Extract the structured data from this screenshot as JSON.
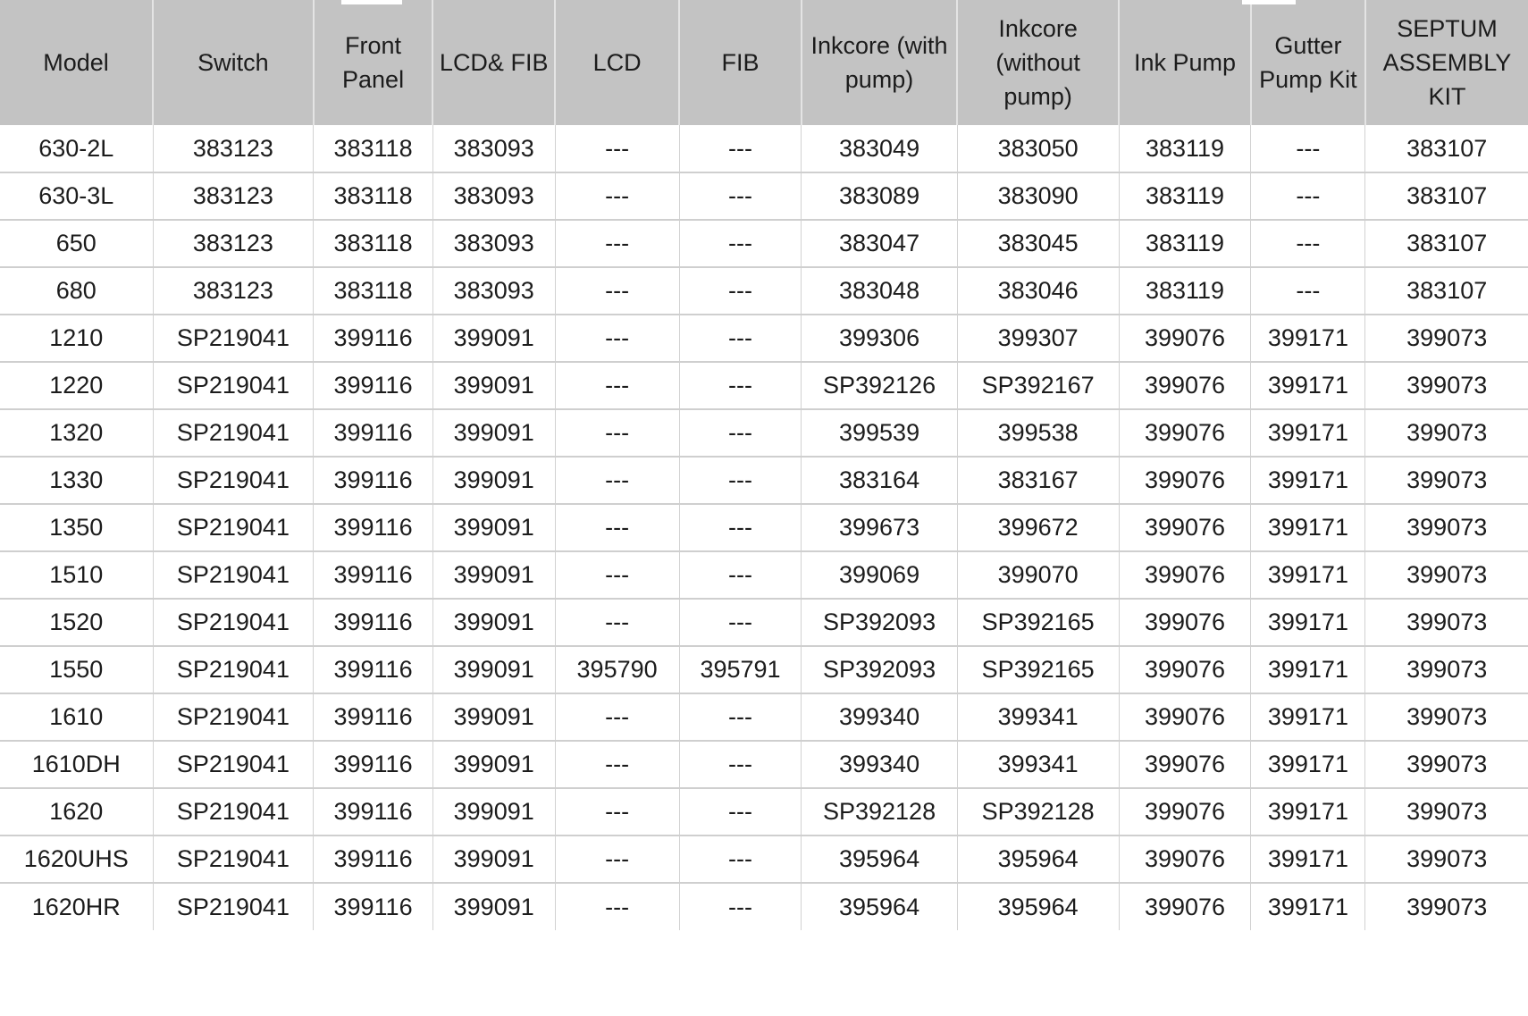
{
  "table": {
    "name": "printer-spare-parts-reference",
    "columns": [
      {
        "key": "model",
        "label": "Model"
      },
      {
        "key": "switch",
        "label": "Switch"
      },
      {
        "key": "front_panel",
        "label": "Front Panel"
      },
      {
        "key": "lcd_fib",
        "label": "LCD& FIB"
      },
      {
        "key": "lcd",
        "label": "LCD"
      },
      {
        "key": "fib",
        "label": "FIB"
      },
      {
        "key": "inkcore_with_pump",
        "label": "Inkcore (with pump)"
      },
      {
        "key": "inkcore_without_pump",
        "label": "Inkcore (without pump)"
      },
      {
        "key": "ink_pump",
        "label": "Ink Pump"
      },
      {
        "key": "gutter_pump_kit",
        "label": "Gutter Pump Kit"
      },
      {
        "key": "septum_assembly_kit",
        "label": "SEPTUM ASSEMBLY KIT"
      }
    ],
    "empty_value": "---",
    "rows": [
      [
        "630-2L",
        "383123",
        "383118",
        "383093",
        "---",
        "---",
        "383049",
        "383050",
        "383119",
        "---",
        "383107"
      ],
      [
        "630-3L",
        "383123",
        "383118",
        "383093",
        "---",
        "---",
        "383089",
        "383090",
        "383119",
        "---",
        "383107"
      ],
      [
        "650",
        "383123",
        "383118",
        "383093",
        "---",
        "---",
        "383047",
        "383045",
        "383119",
        "---",
        "383107"
      ],
      [
        "680",
        "383123",
        "383118",
        "383093",
        "---",
        "---",
        "383048",
        "383046",
        "383119",
        "---",
        "383107"
      ],
      [
        "1210",
        "SP219041",
        "399116",
        "399091",
        "---",
        "---",
        "399306",
        "399307",
        "399076",
        "399171",
        "399073"
      ],
      [
        "1220",
        "SP219041",
        "399116",
        "399091",
        "---",
        "---",
        "SP392126",
        "SP392167",
        "399076",
        "399171",
        "399073"
      ],
      [
        "1320",
        "SP219041",
        "399116",
        "399091",
        "---",
        "---",
        "399539",
        "399538",
        "399076",
        "399171",
        "399073"
      ],
      [
        "1330",
        "SP219041",
        "399116",
        "399091",
        "---",
        "---",
        "383164",
        "383167",
        "399076",
        "399171",
        "399073"
      ],
      [
        "1350",
        "SP219041",
        "399116",
        "399091",
        "---",
        "---",
        "399673",
        "399672",
        "399076",
        "399171",
        "399073"
      ],
      [
        "1510",
        "SP219041",
        "399116",
        "399091",
        "---",
        "---",
        "399069",
        "399070",
        "399076",
        "399171",
        "399073"
      ],
      [
        "1520",
        "SP219041",
        "399116",
        "399091",
        "---",
        "---",
        "SP392093",
        "SP392165",
        "399076",
        "399171",
        "399073"
      ],
      [
        "1550",
        "SP219041",
        "399116",
        "399091",
        "395790",
        "395791",
        "SP392093",
        "SP392165",
        "399076",
        "399171",
        "399073"
      ],
      [
        "1610",
        "SP219041",
        "399116",
        "399091",
        "---",
        "---",
        "399340",
        "399341",
        "399076",
        "399171",
        "399073"
      ],
      [
        "1610DH",
        "SP219041",
        "399116",
        "399091",
        "---",
        "---",
        "399340",
        "399341",
        "399076",
        "399171",
        "399073"
      ],
      [
        "1620",
        "SP219041",
        "399116",
        "399091",
        "---",
        "---",
        "SP392128",
        "SP392128",
        "399076",
        "399171",
        "399073"
      ],
      [
        "1620UHS",
        "SP219041",
        "399116",
        "399091",
        "---",
        "---",
        "395964",
        "395964",
        "399076",
        "399171",
        "399073"
      ],
      [
        "1620HR",
        "SP219041",
        "399116",
        "399091",
        "---",
        "---",
        "395964",
        "395964",
        "399076",
        "399171",
        "399073"
      ]
    ]
  },
  "colors": {
    "header_background": "#c3c3c3",
    "header_divider": "#e4e4e4",
    "cell_background": "#ffffff",
    "cell_border": "#d2d2d2",
    "row_divider": "#cfcfcf",
    "text": "#1c1c1c"
  }
}
